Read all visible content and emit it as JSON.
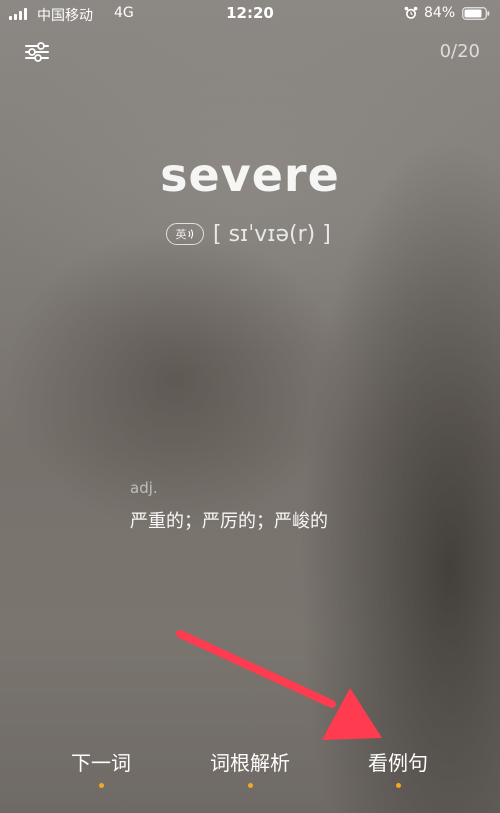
{
  "status_bar": {
    "carrier": "中国移动",
    "network": "4G",
    "time": "12:20",
    "battery": "84%",
    "icons": [
      "signal-icon",
      "alarm-icon",
      "battery-icon"
    ]
  },
  "header": {
    "filter_icon": "sliders-icon",
    "progress": "0/20"
  },
  "word": {
    "text": "severe",
    "pron_label": "英",
    "phonetic": "[ sɪˈvɪə(r) ]"
  },
  "definition": {
    "pos": "adj.",
    "meaning": "严重的；严厉的；严峻的"
  },
  "tabs": [
    {
      "label": "下一词"
    },
    {
      "label": "词根解析"
    },
    {
      "label": "看例句"
    }
  ],
  "colors": {
    "accent_dot": "#f5a623",
    "arrow": "#ff3b4f"
  }
}
